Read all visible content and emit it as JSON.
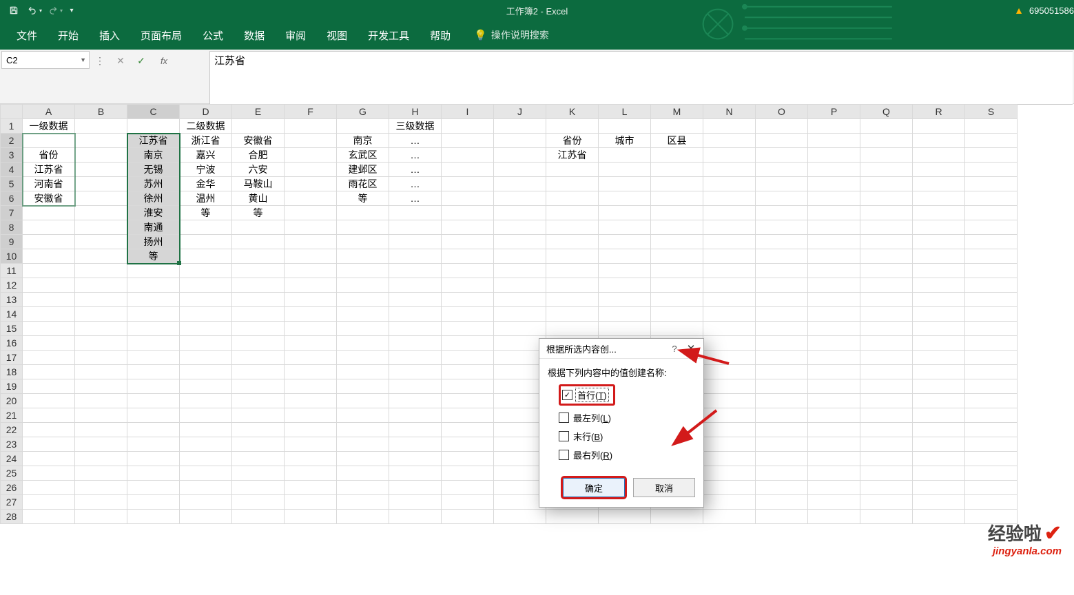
{
  "app": {
    "title": "工作簿2 - Excel",
    "account": "695051586"
  },
  "qat": {
    "save": "save",
    "undo": "undo",
    "redo": "redo",
    "customize": "customize"
  },
  "ribbon": {
    "tabs": [
      "文件",
      "开始",
      "插入",
      "页面布局",
      "公式",
      "数据",
      "审阅",
      "视图",
      "开发工具",
      "帮助"
    ],
    "tell_me": "操作说明搜索"
  },
  "formula_bar": {
    "name_box": "C2",
    "fx": "fx",
    "value": "江苏省"
  },
  "columns": [
    "A",
    "B",
    "C",
    "D",
    "E",
    "F",
    "G",
    "H",
    "I",
    "J",
    "K",
    "L",
    "M",
    "N",
    "O",
    "P",
    "Q",
    "R",
    "S"
  ],
  "row_count": 28,
  "cells": {
    "A1": "一级数据",
    "D1": "二级数据",
    "H1": "三级数据",
    "C2": "江苏省",
    "D2": "浙江省",
    "E2": "安徽省",
    "G2": "南京",
    "H2": "…",
    "K2": "省份",
    "L2": "城市",
    "M2": "区县",
    "A3": "省份",
    "C3": "南京",
    "D3": "嘉兴",
    "E3": "合肥",
    "G3": "玄武区",
    "H3": "…",
    "K3": "江苏省",
    "A4": "江苏省",
    "C4": "无锡",
    "D4": "宁波",
    "E4": "六安",
    "G4": "建邺区",
    "H4": "…",
    "A5": "河南省",
    "C5": "苏州",
    "D5": "金华",
    "E5": "马鞍山",
    "G5": "雨花区",
    "H5": "…",
    "A6": "安徽省",
    "C6": "徐州",
    "D6": "温州",
    "E6": "黄山",
    "G6": "等",
    "H6": "…",
    "C7": "淮安",
    "D7": "等",
    "E7": "等",
    "C8": "南通",
    "C9": "扬州",
    "C10": "等"
  },
  "left_align_cols": [
    "A",
    "K",
    "L",
    "M"
  ],
  "selected_col": "C",
  "selected_rows": [
    2,
    3,
    4,
    5,
    6,
    7,
    8,
    9,
    10
  ],
  "dialog": {
    "title": "根据所选内容创...",
    "help": "?",
    "close": "✕",
    "label": "根据下列内容中的值创建名称:",
    "opts": {
      "top": {
        "label_prefix": "首行(",
        "u": "T",
        "label_suffix": ")",
        "checked": true
      },
      "left": {
        "label_prefix": "最左列(",
        "u": "L",
        "label_suffix": ")",
        "checked": false
      },
      "bottom": {
        "label_prefix": "末行(",
        "u": "B",
        "label_suffix": ")",
        "checked": false
      },
      "right": {
        "label_prefix": "最右列(",
        "u": "R",
        "label_suffix": ")",
        "checked": false
      }
    },
    "ok": "确定",
    "cancel": "取消"
  },
  "watermark": {
    "line1": "经验啦",
    "line2": "jingyanla.com"
  }
}
